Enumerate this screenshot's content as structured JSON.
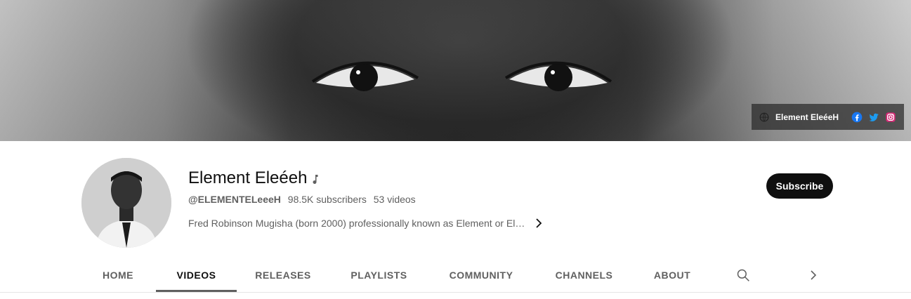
{
  "banner": {
    "links_label": "Element EleéeH",
    "social_icons": [
      "globe-icon",
      "facebook-icon",
      "twitter-icon",
      "instagram-icon"
    ],
    "colors": {
      "facebook": "#1877f2",
      "twitter": "#1d9bf0",
      "instagram": "#d62976"
    }
  },
  "channel": {
    "name": "Element Eleéeh",
    "name_icon": "music-note-icon",
    "handle": "@ELEMENTELeeeH",
    "subscribers": "98.5K subscribers",
    "videos": "53 videos",
    "description": "Fred Robinson Mugisha (born 2000) professionally known as Element or El…"
  },
  "actions": {
    "subscribe_label": "Subscribe"
  },
  "tabs": [
    {
      "label": "HOME",
      "active": false
    },
    {
      "label": "VIDEOS",
      "active": true
    },
    {
      "label": "RELEASES",
      "active": false
    },
    {
      "label": "PLAYLISTS",
      "active": false
    },
    {
      "label": "COMMUNITY",
      "active": false
    },
    {
      "label": "CHANNELS",
      "active": false
    },
    {
      "label": "ABOUT",
      "active": false
    }
  ],
  "tab_icons": [
    "search-icon",
    "chevron-right-icon"
  ]
}
